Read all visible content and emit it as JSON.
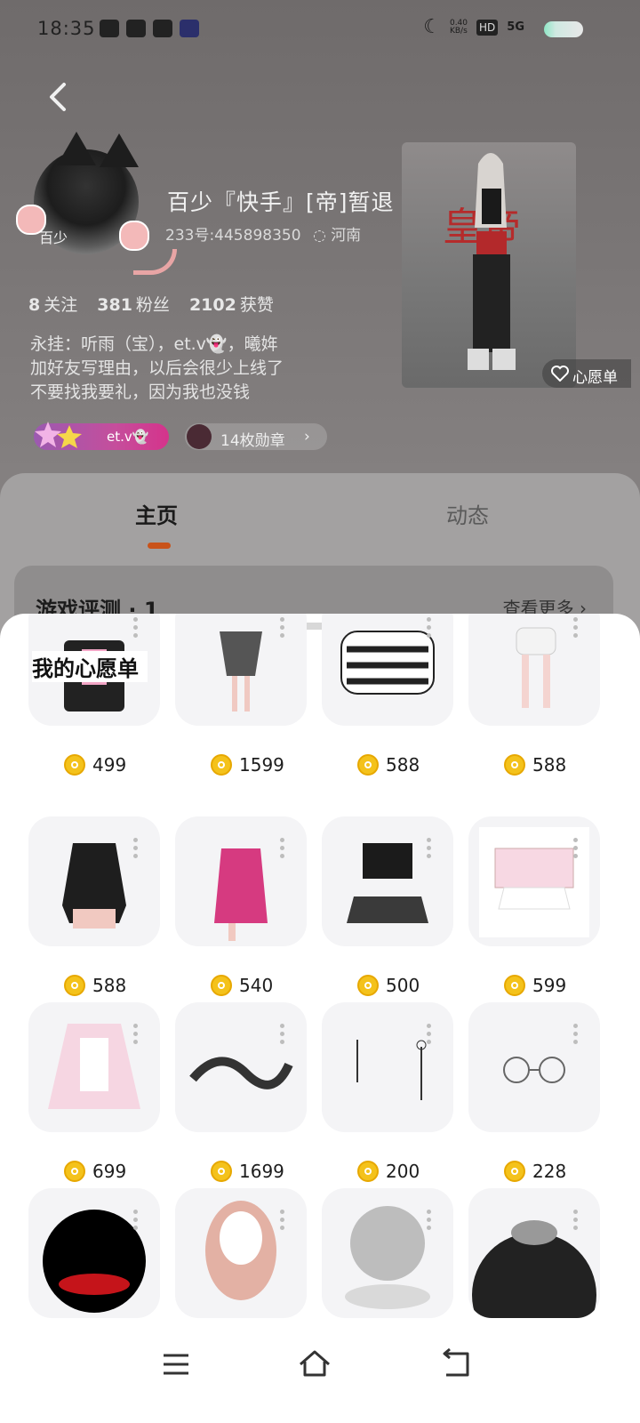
{
  "status_bar": {
    "time": "18:35",
    "net_speed": "0.40\nKB/s",
    "hd": "HD",
    "signal": "5G"
  },
  "profile": {
    "name": "百少『快手』[帝]暂退",
    "id_line": "233号:445898350",
    "location": "河南",
    "avatar_text": "百少",
    "stats": [
      {
        "value": "8",
        "label": "关注"
      },
      {
        "value": "381",
        "label": "粉丝"
      },
      {
        "value": "2102",
        "label": "获赞"
      }
    ],
    "bio": "永挂：听雨（宝），et.v👻，曦姩\n加好友写理由，以后会很少上线了\n不要找我要礼，因为我也没钱",
    "badge_friend": "et.v👻",
    "badge_medals": "14枚勋章",
    "wishlist_button": "心愿单",
    "character_sign": "皇帝"
  },
  "tabs": [
    {
      "label": "主页",
      "active": true
    },
    {
      "label": "动态",
      "active": false
    }
  ],
  "review": {
    "title": "游戏评测 · 1",
    "more": "查看更多"
  },
  "wishlist": {
    "title": "我的心愿单",
    "items": [
      {
        "price": "499",
        "icon": "black-pink-tshirt-dress-icon"
      },
      {
        "price": "1599",
        "icon": "gothic-skirt-legs-icon"
      },
      {
        "price": "588",
        "icon": "striped-sweater-icon"
      },
      {
        "price": "588",
        "icon": "white-skirt-legs-icon"
      },
      {
        "price": "588",
        "icon": "black-bodysuit-icon"
      },
      {
        "price": "540",
        "icon": "pink-sequin-dress-icon"
      },
      {
        "price": "500",
        "icon": "black-tee-plaid-skirt-icon"
      },
      {
        "price": "599",
        "icon": "pink-striped-top-icon"
      },
      {
        "price": "699",
        "icon": "pink-maid-dress-icon"
      },
      {
        "price": "1699",
        "icon": "black-dragon-icon"
      },
      {
        "price": "200",
        "icon": "moon-earrings-icon"
      },
      {
        "price": "228",
        "icon": "glasses-icon"
      },
      {
        "price": "",
        "icon": "red-glow-effect-icon"
      },
      {
        "price": "",
        "icon": "pink-braids-hair-icon"
      },
      {
        "price": "",
        "icon": "winged-halo-icon"
      },
      {
        "price": "",
        "icon": "dark-moon-scene-icon"
      }
    ]
  },
  "colors": {
    "accent": "#c9531a",
    "coin": "#f4c21b",
    "badge_pink": "#d5338b"
  }
}
